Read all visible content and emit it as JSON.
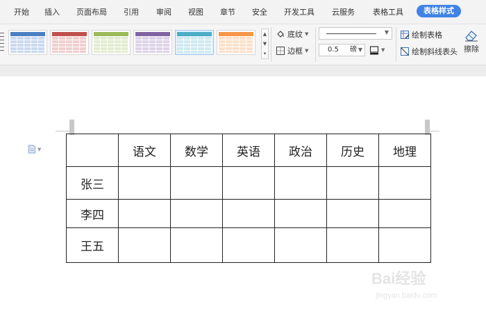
{
  "tabs": [
    "开始",
    "插入",
    "页面布局",
    "引用",
    "审阅",
    "视图",
    "章节",
    "安全",
    "开发工具",
    "云服务",
    "表格工具",
    "表格样式"
  ],
  "active_tab": "表格样式",
  "ribbon": {
    "shading_label": "底纹",
    "border_label": "边框",
    "line_weight_value": "0.5",
    "line_weight_unit": "磅",
    "draw_table_label": "绘制表格",
    "draw_diagonal_label": "绘制斜线表头",
    "eraser_label": "擦除"
  },
  "style_gallery": {
    "styles": [
      {
        "name": "blue",
        "color": "#4a7fc1",
        "light": "#c9d9f0"
      },
      {
        "name": "red",
        "color": "#c0504d",
        "light": "#f0cfce"
      },
      {
        "name": "green",
        "color": "#9bbb59",
        "light": "#e2ecd0"
      },
      {
        "name": "purple",
        "color": "#8064a2",
        "light": "#ddd3e8"
      },
      {
        "name": "teal",
        "color": "#4bacc6",
        "light": "#cfe9f0"
      },
      {
        "name": "orange",
        "color": "#f79646",
        "light": "#fce0c9"
      }
    ]
  },
  "table": {
    "headers": [
      "",
      "语文",
      "数学",
      "英语",
      "政治",
      "历史",
      "地理"
    ],
    "rows": [
      {
        "name": "张三",
        "cells": [
          "",
          "",
          "",
          "",
          "",
          ""
        ]
      },
      {
        "name": "李四",
        "cells": [
          "",
          "",
          "",
          "",
          "",
          ""
        ]
      },
      {
        "name": "王五",
        "cells": [
          "",
          "",
          "",
          "",
          "",
          ""
        ]
      }
    ]
  },
  "watermark": {
    "main": "Bai经验",
    "sub": "jingyan.baidu.com"
  }
}
